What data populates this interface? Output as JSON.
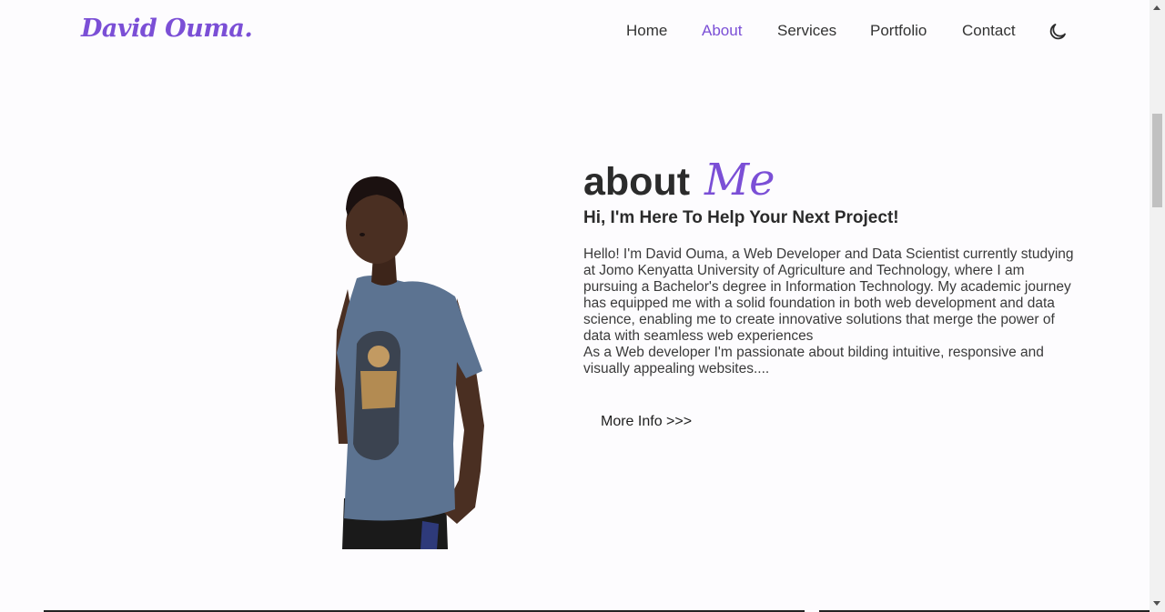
{
  "header": {
    "logo": "David Ouma.",
    "nav": [
      {
        "label": "Home",
        "active": false
      },
      {
        "label": "About",
        "active": true
      },
      {
        "label": "Services",
        "active": false
      },
      {
        "label": "Portfolio",
        "active": false
      },
      {
        "label": "Contact",
        "active": false
      }
    ],
    "theme_icon": "moon-icon"
  },
  "about": {
    "title_main": "about",
    "title_accent": "Me",
    "subtitle": "Hi, I'm Here To Help Your Next Project!",
    "bio_paragraphs": [
      "Hello! I'm David Ouma, a Web Developer and Data Scientist currently studying at Jomo Kenyatta University of Agriculture and Technology, where I am pursuing a Bachelor's degree in Information Technology. My academic journey has equipped me with a solid foundation in both web development and data science, enabling me to create innovative solutions that merge the power of data with seamless web experiences",
      "As a Web developer I'm passionate about bilding intuitive, responsive and visually appealing websites...."
    ],
    "more_button": "More Info >>>"
  },
  "colors": {
    "accent": "#7b4fd6",
    "text": "#2b2b2b",
    "background": "#fdfcfe"
  }
}
